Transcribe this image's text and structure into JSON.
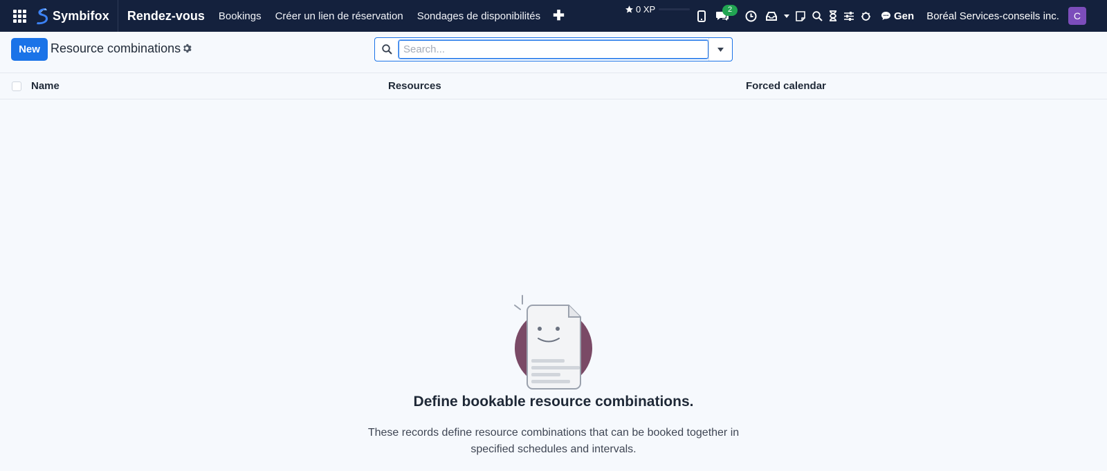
{
  "navbar": {
    "brand": "Symbifox",
    "module": "Rendez-vous",
    "menu": [
      "Bookings",
      "Créer un lien de réservation",
      "Sondages de disponibilités"
    ],
    "xp": "0 XP",
    "messages_count": "2",
    "chat_label": "Gen",
    "company": "Boréal Services-conseils inc.",
    "avatar_initial": "C"
  },
  "control": {
    "new_label": "New",
    "title": "Resource combinations",
    "search_placeholder": "Search..."
  },
  "list": {
    "columns": [
      "Name",
      "Resources",
      "Forced calendar"
    ]
  },
  "empty_state": {
    "title": "Define bookable resource combinations.",
    "text": "These records define resource combinations that can be booked together in specified schedules and intervals."
  },
  "colors": {
    "navbar": "#14213d",
    "primary": "#1a73e8",
    "badge": "#21a452",
    "avatar": "#7c4dbb",
    "illustration_circle": "#7a4a66"
  }
}
